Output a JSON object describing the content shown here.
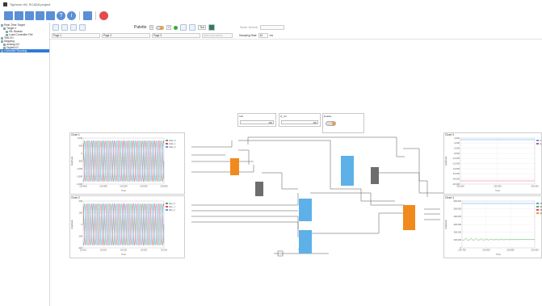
{
  "window": {
    "title": "Typhoon HIL SCADA project"
  },
  "tree": [
    {
      "label": "Real-Time Target",
      "level": 0
    },
    {
      "label": "Target 1",
      "level": 1
    },
    {
      "label": "HIL Boards",
      "level": 2
    },
    {
      "label": "Load Controller File",
      "level": 2
    },
    {
      "label": "Test I/O",
      "level": 0
    },
    {
      "label": "Mapping",
      "level": 0
    },
    {
      "label": "Analog I/O",
      "level": 1
    },
    {
      "label": "Digital I/O",
      "level": 1
    },
    {
      "label": "Controller Running",
      "level": 0,
      "selected": true
    }
  ],
  "ribbon": {
    "palette_label": "Palette",
    "palette_value_1": "0",
    "palette_value_2": "0",
    "btn_text": "Text",
    "mode_label": "Mode: Normal"
  },
  "pages": {
    "tabs": [
      "Page 1",
      "Page 2",
      "Page 3"
    ],
    "add_button": "Add Lock screen",
    "sampling_label": "Sampling Rate",
    "sampling_value": "10",
    "sampling_unit": "ms"
  },
  "knobs": [
    {
      "label": "Vdc",
      "value": "400"
    },
    {
      "label": "Q_ref",
      "value": "400"
    },
    {
      "label": "Enable",
      "value": ""
    }
  ],
  "charts": {
    "chart1": {
      "title": "Chart 1",
      "ylabel": "Amplitude",
      "xlabel": "Time",
      "yticks": [
        "1,000",
        "500",
        "0",
        "-500",
        "-1,000",
        "-1,500",
        "-2,000"
      ],
      "xticks": [
        "124.800",
        "124.805",
        "124.810",
        "124.815",
        "124.820"
      ],
      "legend": [
        "Vabc_0",
        "Vabc_1",
        "Vabc_2"
      ]
    },
    "chart2": {
      "title": "Chart 2",
      "ylabel": "Amplitude",
      "xlabel": "Time",
      "yticks": [
        "200",
        "100",
        "0",
        "-100",
        "-200"
      ],
      "xticks": [
        "22.010",
        "22.015",
        "22.020",
        "22.025",
        "22.030"
      ],
      "legend": [
        "Iabc_0",
        "Iabc_1",
        "Iabc_2"
      ]
    },
    "chart3": {
      "title": "Chart 3",
      "ylabel": "Amplitude",
      "xlabel": "Time",
      "yticks": [
        "-2,000",
        "-4,000",
        "-6,000",
        "-8,000",
        "-10,000",
        "-12,000",
        "-14,000",
        "-16,000",
        "-18,000",
        "-20,000"
      ],
      "xticks": [
        "120.000",
        "125.000",
        "130.000"
      ],
      "legend": [
        "P",
        "Q"
      ]
    },
    "chart4": {
      "title": "Chart 4",
      "ylabel": "Amplitude",
      "xlabel": "Time",
      "yticks": [
        "600,000",
        "500,000",
        "400,000",
        "300,000",
        "200,000",
        "100,000",
        "0"
      ],
      "xticks": [
        "120.750",
        "120.800",
        "120.850",
        "120.900"
      ],
      "legend": [
        "Vdc",
        "Idc",
        "Pdc",
        "Qdc"
      ]
    }
  },
  "colors": {
    "accent": "#2f7bd8",
    "orange_block": "#f08a1c",
    "blue_block": "#5db0e8",
    "gray_block": "#6d6d6d",
    "wave_a": "#4caf50",
    "wave_b": "#ec407a",
    "wave_c": "#42a5f5"
  }
}
